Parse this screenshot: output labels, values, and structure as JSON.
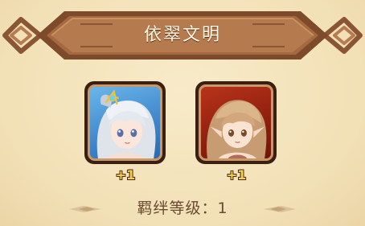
{
  "banner": {
    "title": "依翠文明"
  },
  "cards": [
    {
      "name": "character-card-silver-hair",
      "bonus": "+1"
    },
    {
      "name": "character-card-brown-hair",
      "bonus": "+1"
    }
  ],
  "bond": {
    "label": "羁绊等级：",
    "level": "1"
  },
  "colors": {
    "background": "#f5e6c1",
    "banner": "#a56a45",
    "bonus": "#f4d34a",
    "text": "#6b4a32"
  }
}
